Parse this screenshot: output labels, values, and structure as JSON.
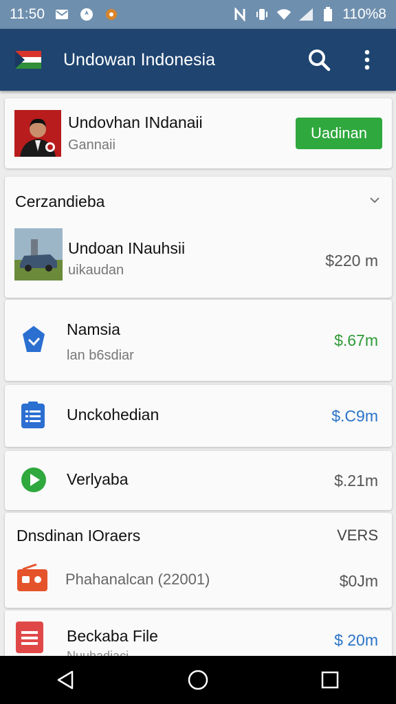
{
  "status_bar": {
    "time": "11:50",
    "battery": "110%8"
  },
  "app_bar": {
    "title": "Undowan Indonesia"
  },
  "profile": {
    "name": "Undovhan INdanaii",
    "subtitle": "Gannaii",
    "button": "Uadinan"
  },
  "section1": {
    "title": "Cerzandieba",
    "items": [
      {
        "title": "Undoan INauhsii",
        "desc": "uikaudan",
        "price": "$220 m",
        "price_color": "#555555"
      },
      {
        "title": "Namsia",
        "desc": "lan b6sdiar",
        "price": "$.67m",
        "price_color": "#2f9a37"
      },
      {
        "title": "Unckohedian",
        "desc": "",
        "price": "$.C9m",
        "price_color": "#2a73c8"
      },
      {
        "title": "Verlyaba",
        "desc": "",
        "price": "$.21m",
        "price_color": "#555555"
      }
    ]
  },
  "section2": {
    "title": "Dnsdinan IOraers",
    "right_label": "VERS",
    "items": [
      {
        "title": "Phahanalcan (22001)",
        "price": "$0Jm"
      },
      {
        "title": "Beckaba File",
        "desc": "Nuuhadiaci",
        "price": "$ 20m"
      }
    ]
  },
  "colors": {
    "app_bar": "#1f4470",
    "status_bar": "#6f8fae",
    "accent_green": "#2fa83e"
  }
}
